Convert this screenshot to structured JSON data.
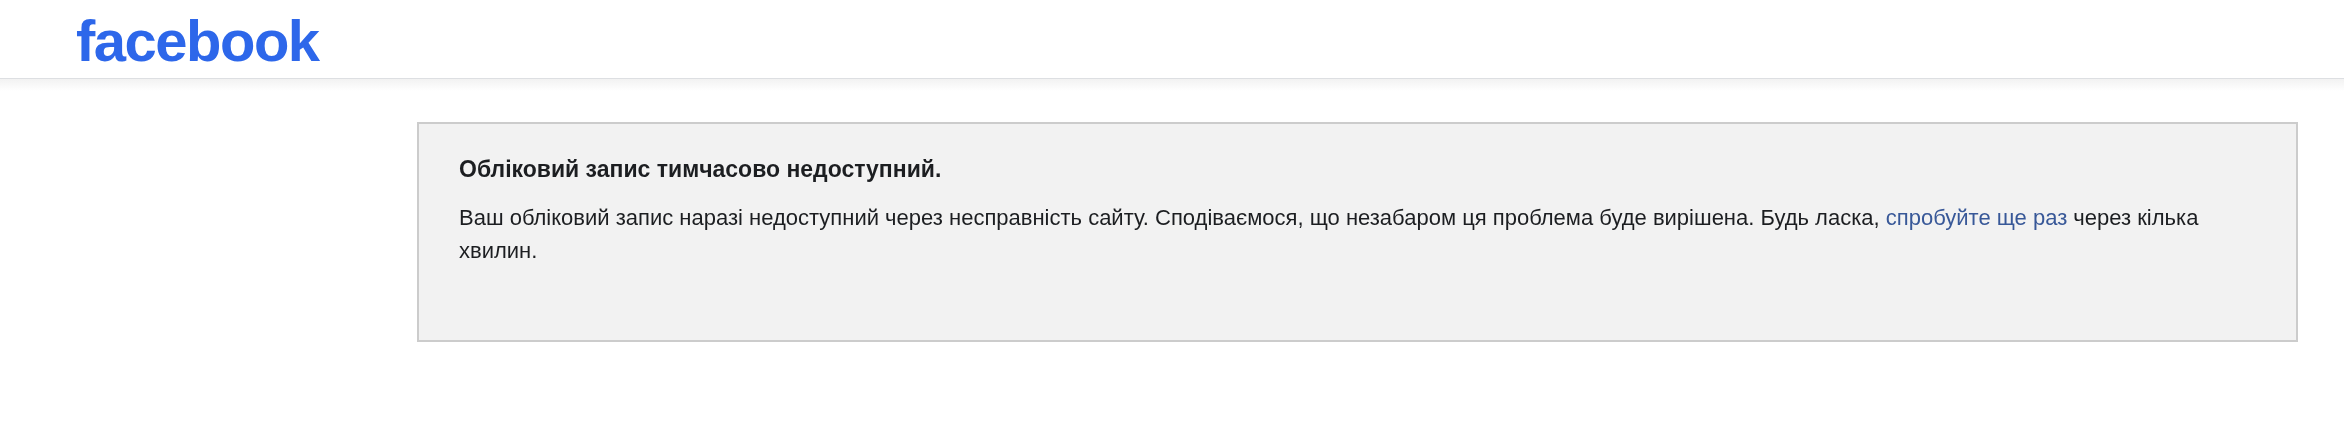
{
  "header": {
    "logo": "facebook"
  },
  "message": {
    "title": "Обліковий запис тимчасово недоступний.",
    "text_before": "Ваш обліковий запис наразі недоступний через несправність сайту. Сподіваємося, що незабаром ця проблема буде вирішена. Будь ласка,",
    "link": "спробуйте ще раз",
    "text_after": "через кілька хвилин."
  }
}
